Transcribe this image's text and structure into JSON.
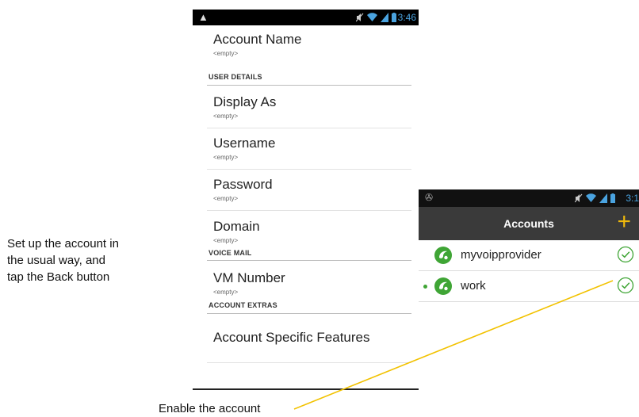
{
  "settings_screen": {
    "status": {
      "time": "3:46",
      "warning_icon": "warning-icon"
    },
    "account_name": {
      "title": "Account Name",
      "summary": "<empty>"
    },
    "user_details": {
      "header": "USER DETAILS",
      "display_as": {
        "title": "Display As",
        "summary": "<empty>"
      },
      "username": {
        "title": "Username",
        "summary": "<empty>"
      },
      "password": {
        "title": "Password",
        "summary": "<empty>"
      },
      "domain": {
        "title": "Domain",
        "summary": "<empty>"
      }
    },
    "voice_mail": {
      "header": "VOICE MAIL",
      "vm_number": {
        "title": "VM Number",
        "summary": "<empty>"
      }
    },
    "account_extras": {
      "header": "ACCOUNT EXTRAS",
      "specific_features": {
        "title": "Account Specific Features"
      }
    }
  },
  "accounts_screen": {
    "status": {
      "time": "3:1"
    },
    "title": "Accounts",
    "add_label": "+",
    "accounts": [
      {
        "name": "myvoipprovider",
        "enabled": true,
        "active": false
      },
      {
        "name": "work",
        "enabled": true,
        "active": true
      }
    ],
    "colors": {
      "accent_green": "#3fa535",
      "add_orange": "#f0b90b",
      "actionbar": "#3a3a3a"
    }
  },
  "annotations": {
    "setup_line1": "Set up the account in",
    "setup_line2": "the usual way, and",
    "setup_line3": "tap the Back button",
    "enable": "Enable the account"
  }
}
